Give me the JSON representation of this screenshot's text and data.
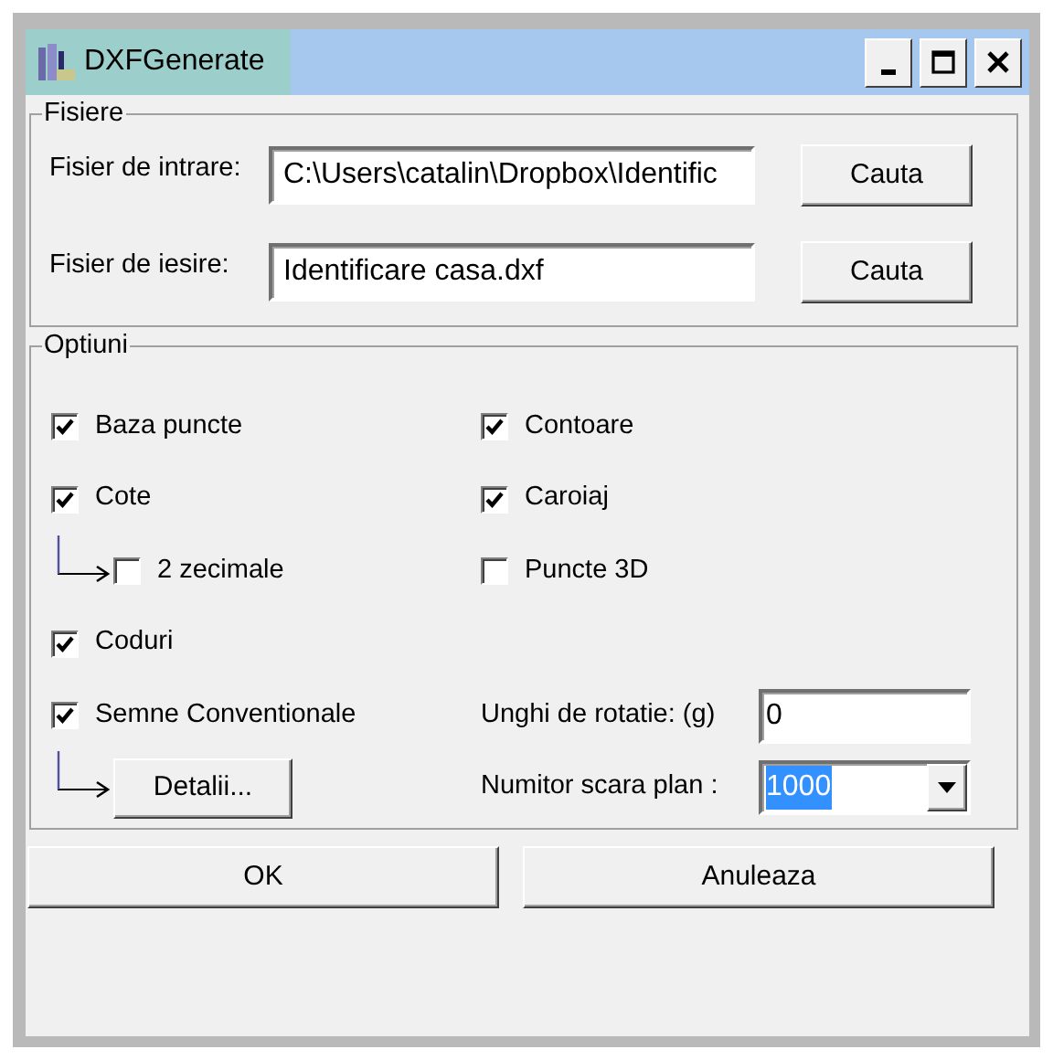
{
  "window": {
    "title": "DXFGenerate"
  },
  "files": {
    "legend": "Fisiere",
    "rows": [
      {
        "label": "Fisier de intrare:",
        "value": "C:\\Users\\catalin\\Dropbox\\Identific",
        "button": "Cauta"
      },
      {
        "label": "Fisier de iesire:",
        "value": "Identificare casa.dxf",
        "button": "Cauta"
      }
    ]
  },
  "options": {
    "legend": "Optiuni",
    "left": [
      {
        "kind": "checkbox",
        "label": "Baza puncte",
        "checked": true
      },
      {
        "kind": "checkbox",
        "label": "Cote",
        "checked": true,
        "children": [
          {
            "kind": "checkbox",
            "label": "2 zecimale",
            "checked": false
          }
        ]
      },
      {
        "kind": "checkbox",
        "label": "Coduri",
        "checked": true
      },
      {
        "kind": "checkbox",
        "label": "Semne Conventionale",
        "checked": true,
        "children": [
          {
            "kind": "button",
            "label": "Detalii..."
          }
        ]
      }
    ],
    "right": [
      {
        "kind": "checkbox",
        "label": "Contoare",
        "checked": true
      },
      {
        "kind": "checkbox",
        "label": "Caroiaj",
        "checked": true
      },
      {
        "kind": "checkbox",
        "label": "Puncte 3D",
        "checked": false
      }
    ],
    "fields": [
      {
        "kind": "text",
        "label": "Unghi de rotatie: (g)",
        "value": "0",
        "highlighted": false
      },
      {
        "kind": "combo",
        "label": "Numitor scara plan :",
        "value": "1000",
        "highlighted": true
      }
    ]
  },
  "buttons": [
    "OK",
    "Anuleaza"
  ]
}
